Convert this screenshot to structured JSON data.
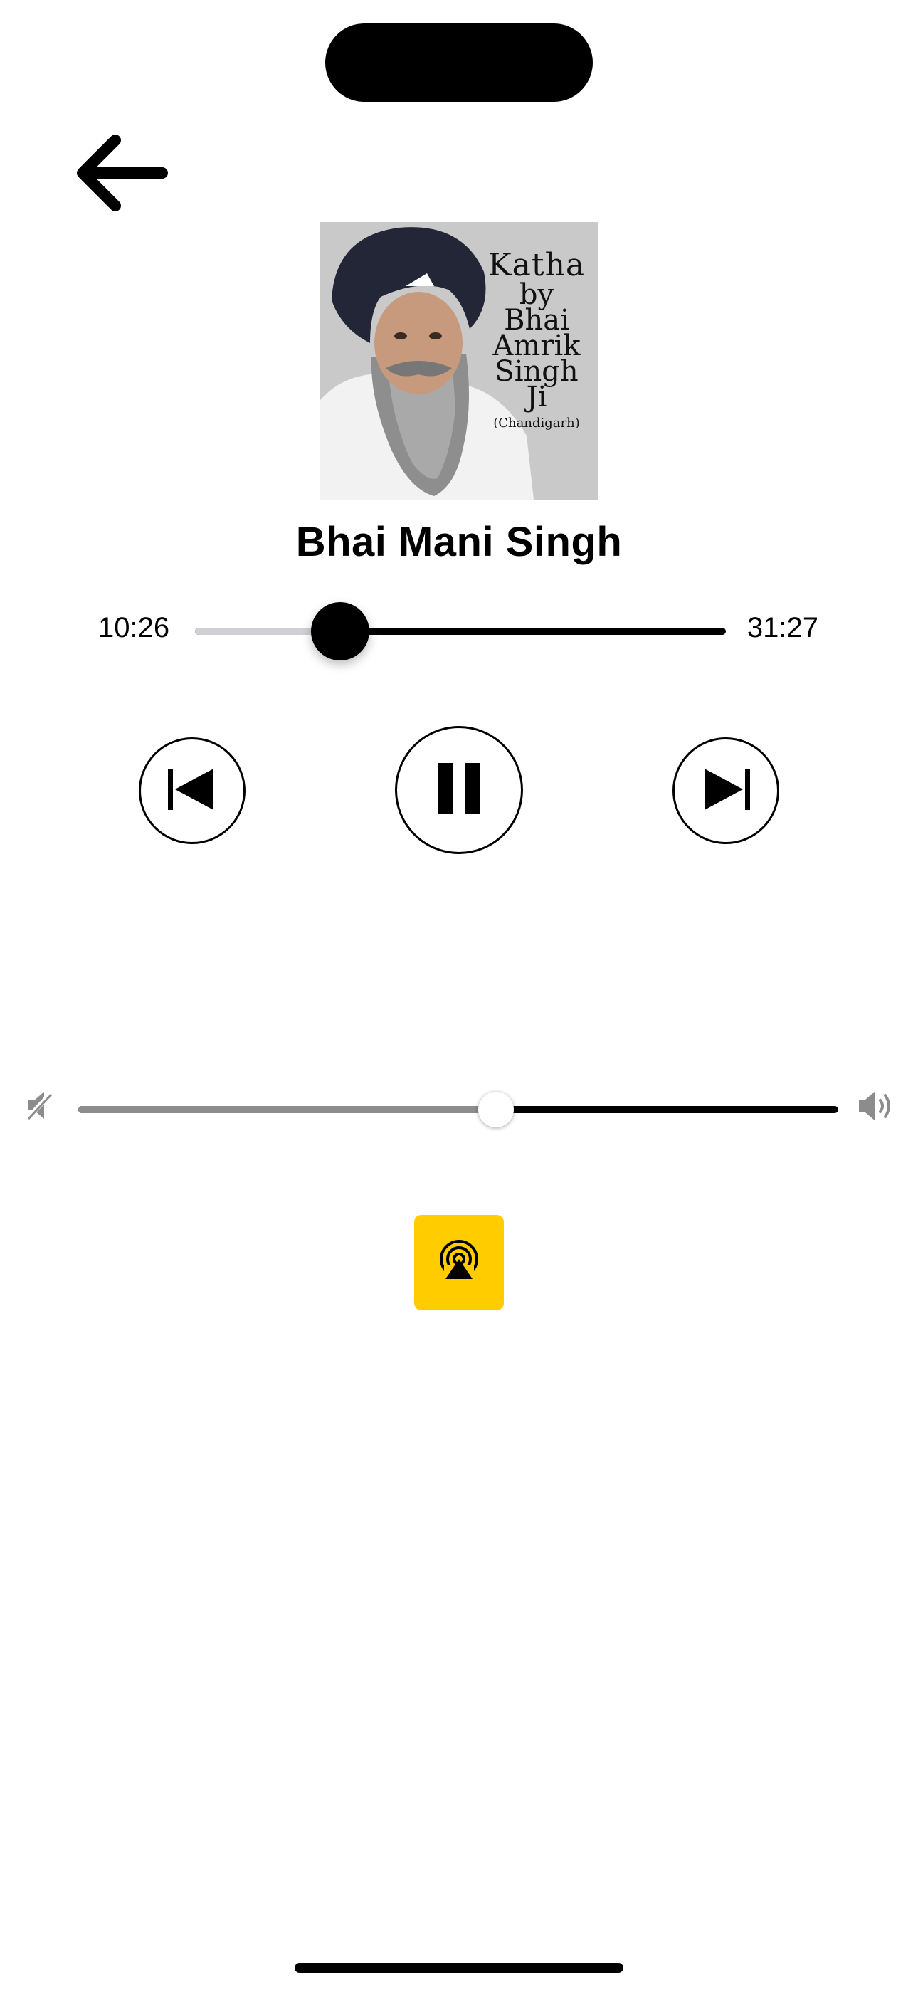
{
  "player": {
    "track_title": "Bhai Mani Singh",
    "elapsed": "10:26",
    "duration": "31:27",
    "progress_fraction": 0.274
  },
  "album_art": {
    "line1": "Katha",
    "line2": "by",
    "line3": "Bhai",
    "line4": "Amrik",
    "line5": "Singh",
    "line6": "Ji",
    "line7": "(Chandigarh)"
  },
  "controls": {
    "back_icon": "arrow-left-icon",
    "previous_icon": "skip-previous-icon",
    "pause_icon": "pause-icon",
    "next_icon": "skip-next-icon"
  },
  "volume": {
    "level_fraction": 0.55,
    "min_icon": "speaker-mute-icon",
    "max_icon": "speaker-loud-icon"
  },
  "airplay": {
    "icon": "airplay-audio-icon",
    "color": "#ffcc00"
  }
}
